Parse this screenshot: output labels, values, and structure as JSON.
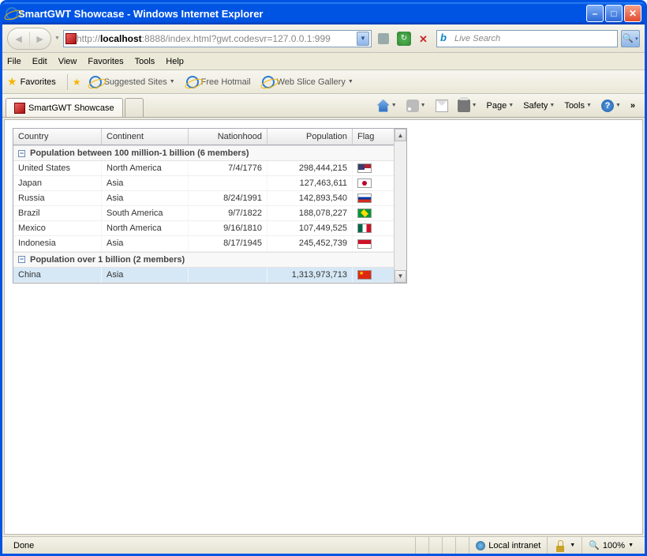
{
  "window": {
    "title": "SmartGWT Showcase - Windows Internet Explorer"
  },
  "nav": {
    "url_scheme": "http://",
    "url_host": "localhost",
    "url_rest": ":8888/index.html?gwt.codesvr=127.0.0.1:999",
    "search_placeholder": "Live Search"
  },
  "menu": {
    "file": "File",
    "edit": "Edit",
    "view": "View",
    "favorites": "Favorites",
    "tools": "Tools",
    "help": "Help"
  },
  "favbar": {
    "label": "Favorites",
    "suggested": "Suggested Sites",
    "hotmail": "Free Hotmail",
    "webslice": "Web Slice Gallery"
  },
  "tab": {
    "title": "SmartGWT Showcase"
  },
  "toolbar": {
    "page": "Page",
    "safety": "Safety",
    "tools": "Tools"
  },
  "grid": {
    "headers": {
      "country": "Country",
      "continent": "Continent",
      "nationhood": "Nationhood",
      "population": "Population",
      "flag": "Flag"
    },
    "group1": {
      "label": "Population between 100 million-1 billion (6 members)"
    },
    "group2": {
      "label": "Population over 1 billion (2 members)"
    },
    "rows1": [
      {
        "country": "United States",
        "continent": "North America",
        "nationhood": "7/4/1776",
        "population": "298,444,215",
        "flag": "us"
      },
      {
        "country": "Japan",
        "continent": "Asia",
        "nationhood": "",
        "population": "127,463,611",
        "flag": "jp"
      },
      {
        "country": "Russia",
        "continent": "Asia",
        "nationhood": "8/24/1991",
        "population": "142,893,540",
        "flag": "ru"
      },
      {
        "country": "Brazil",
        "continent": "South America",
        "nationhood": "9/7/1822",
        "population": "188,078,227",
        "flag": "br"
      },
      {
        "country": "Mexico",
        "continent": "North America",
        "nationhood": "9/16/1810",
        "population": "107,449,525",
        "flag": "mx"
      },
      {
        "country": "Indonesia",
        "continent": "Asia",
        "nationhood": "8/17/1945",
        "population": "245,452,739",
        "flag": "id"
      }
    ],
    "rows2": [
      {
        "country": "China",
        "continent": "Asia",
        "nationhood": "",
        "population": "1,313,973,713",
        "flag": "cn"
      }
    ]
  },
  "status": {
    "text": "Done",
    "zone": "Local intranet",
    "zoom": "100%"
  }
}
